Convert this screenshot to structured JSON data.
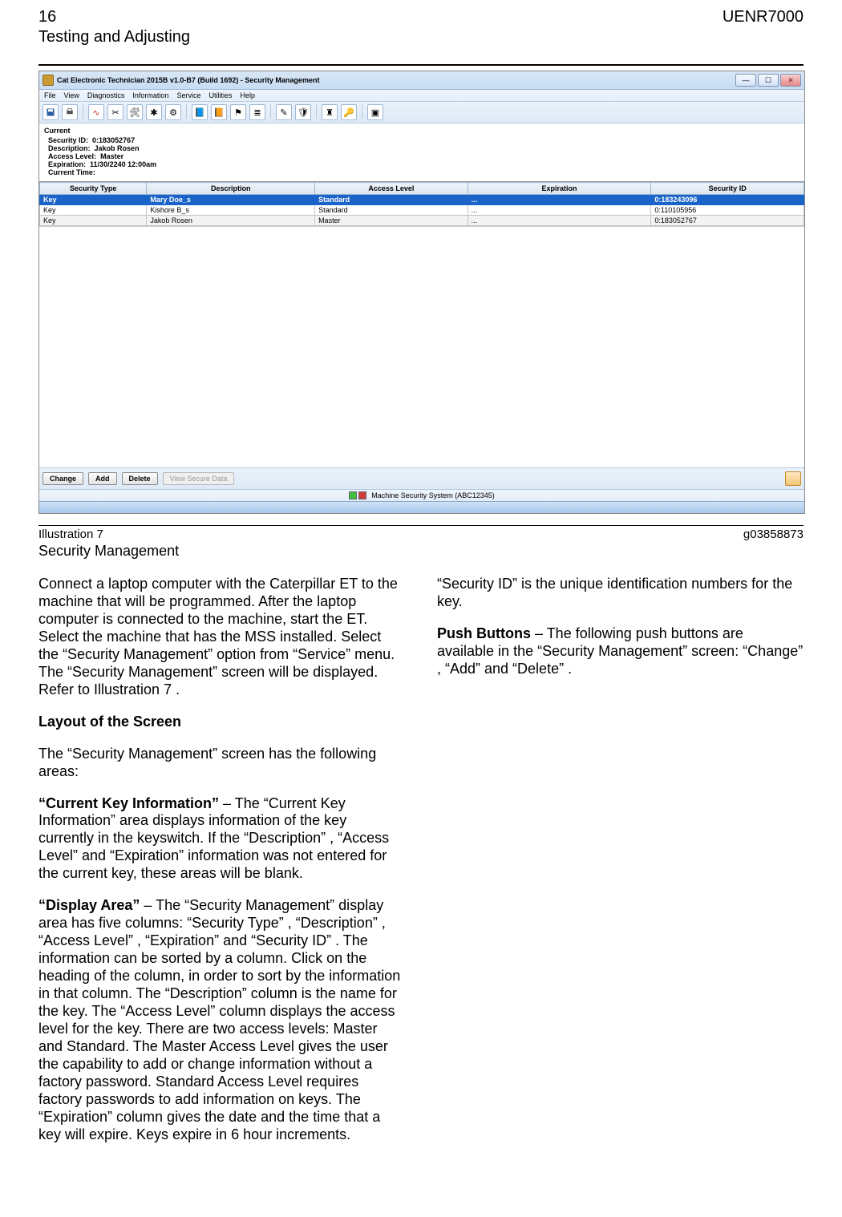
{
  "header": {
    "pageNumber": "16",
    "docCode": "UENR7000",
    "section": "Testing and Adjusting"
  },
  "screenshot": {
    "title": "Cat Electronic Technician 2015B v1.0-B7 (Build 1692) - Security Management",
    "menu": [
      "File",
      "View",
      "Diagnostics",
      "Information",
      "Service",
      "Utilities",
      "Help"
    ],
    "current": {
      "title": "Current",
      "id_label": "Security ID:",
      "id_value": "0:183052767",
      "desc_label": "Description:",
      "desc_value": "Jakob Rosen",
      "level_label": "Access Level:",
      "level_value": "Master",
      "exp_label": "Expiration:",
      "exp_value": "11/30/2240 12:00am",
      "time_label": "Current Time:"
    },
    "columns": [
      "Security Type",
      "Description",
      "Access Level",
      "Expiration",
      "Security ID"
    ],
    "rows": [
      {
        "type": "Key",
        "desc": "Mary Doe_s",
        "level": "Standard",
        "exp": "...",
        "id": "0:183243096"
      },
      {
        "type": "Key",
        "desc": "Kishore B_s",
        "level": "Standard",
        "exp": "...",
        "id": "0:110105956"
      },
      {
        "type": "Key",
        "desc": "Jakob Rosen",
        "level": "Master",
        "exp": "...",
        "id": "0:183052767"
      }
    ],
    "buttons": {
      "change": "Change",
      "add": "Add",
      "delete": "Delete",
      "viewSecure": "View Secure Data"
    },
    "status": "Machine Security System (ABC12345)"
  },
  "caption": {
    "left": "Illustration 7",
    "right": "g03858873",
    "sub": "Security Management"
  },
  "body": {
    "p1": "Connect a laptop computer with the Caterpillar   ET to the machine that will be programmed. After the laptop computer is connected to the machine, start the ET. Select the machine that has the MSS installed. Select the  “Security Management”  option from  “Service” menu. The  “Security Management”  screen will be displayed. Refer to Illustration 7 .",
    "h1": "Layout of the Screen",
    "p2": "The  “Security Management”  screen has the following areas:",
    "p3a": " “Current Key Information” ",
    "p3b": " – The  “Current Key Information”  area displays information of the key currently in the keyswitch. If the  “Description” ,  “Access Level”  and  “Expiration”  information was not entered for the current key, these areas will be blank.",
    "p4a": " “Display Area” ",
    "p4b": " – The  “Security Management” display area has five columns:  “Security Type” ,  “Description” ,  “Access Level” ,  “Expiration”  and  “Security ID” . The information can be sorted by a column. Click on the heading of the column, in order to sort by the information in that column. The  “Description”  column is the name for the key. The  “Access Level”  column displays the access level for the key. There are two access levels: Master and Standard. The Master Access Level gives the user the capability to add or change information without a factory password. Standard Access Level requires factory passwords to add information on keys. The  “Expiration”  column gives the date and the time that a key will expire. Keys expire in 6 hour increments.",
    "p5": "“Security ID”  is the unique identification numbers for the key.",
    "p6a": "Push Buttons",
    "p6b": " – The following push buttons are available in the  “Security Management”  screen:  “Change” ,  “Add”  and  “Delete” ."
  }
}
